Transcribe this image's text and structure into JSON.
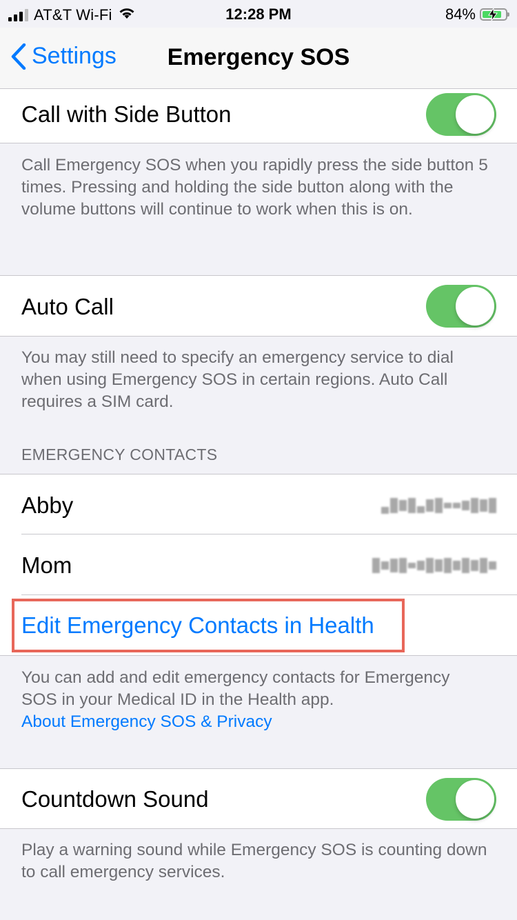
{
  "status_bar": {
    "carrier": "AT&T Wi-Fi",
    "time": "12:28 PM",
    "battery_percent": "84%",
    "battery_level": 0.84,
    "signal_icon": "signal-bars-icon",
    "wifi_icon": "wifi-icon",
    "battery_icon": "battery-charging-icon"
  },
  "nav": {
    "back_label": "Settings",
    "title": "Emergency SOS"
  },
  "call_with_side_button": {
    "label": "Call with Side Button",
    "enabled": true,
    "footer": "Call Emergency SOS when you rapidly press the side button 5 times. Pressing and holding the side button along with the volume buttons will continue to work when this is on."
  },
  "auto_call": {
    "label": "Auto Call",
    "enabled": true,
    "footer": "You may still need to specify an emergency service to dial when using Emergency SOS in certain regions. Auto Call requires a SIM card."
  },
  "emergency_contacts": {
    "header": "EMERGENCY CONTACTS",
    "contacts": [
      {
        "name": "Abby"
      },
      {
        "name": "Mom"
      }
    ],
    "edit_link": "Edit Emergency Contacts in Health",
    "footer": "You can add and edit emergency contacts for Emergency SOS in your Medical ID in the Health app.",
    "about_link": "About Emergency SOS & Privacy"
  },
  "countdown_sound": {
    "label": "Countdown Sound",
    "enabled": true,
    "footer": "Play a warning sound while Emergency SOS is counting down to call emergency services."
  },
  "colors": {
    "accent": "#007aff",
    "toggle_on": "#65c466",
    "highlight_box": "#e8675a",
    "background": "#f2f2f7"
  }
}
